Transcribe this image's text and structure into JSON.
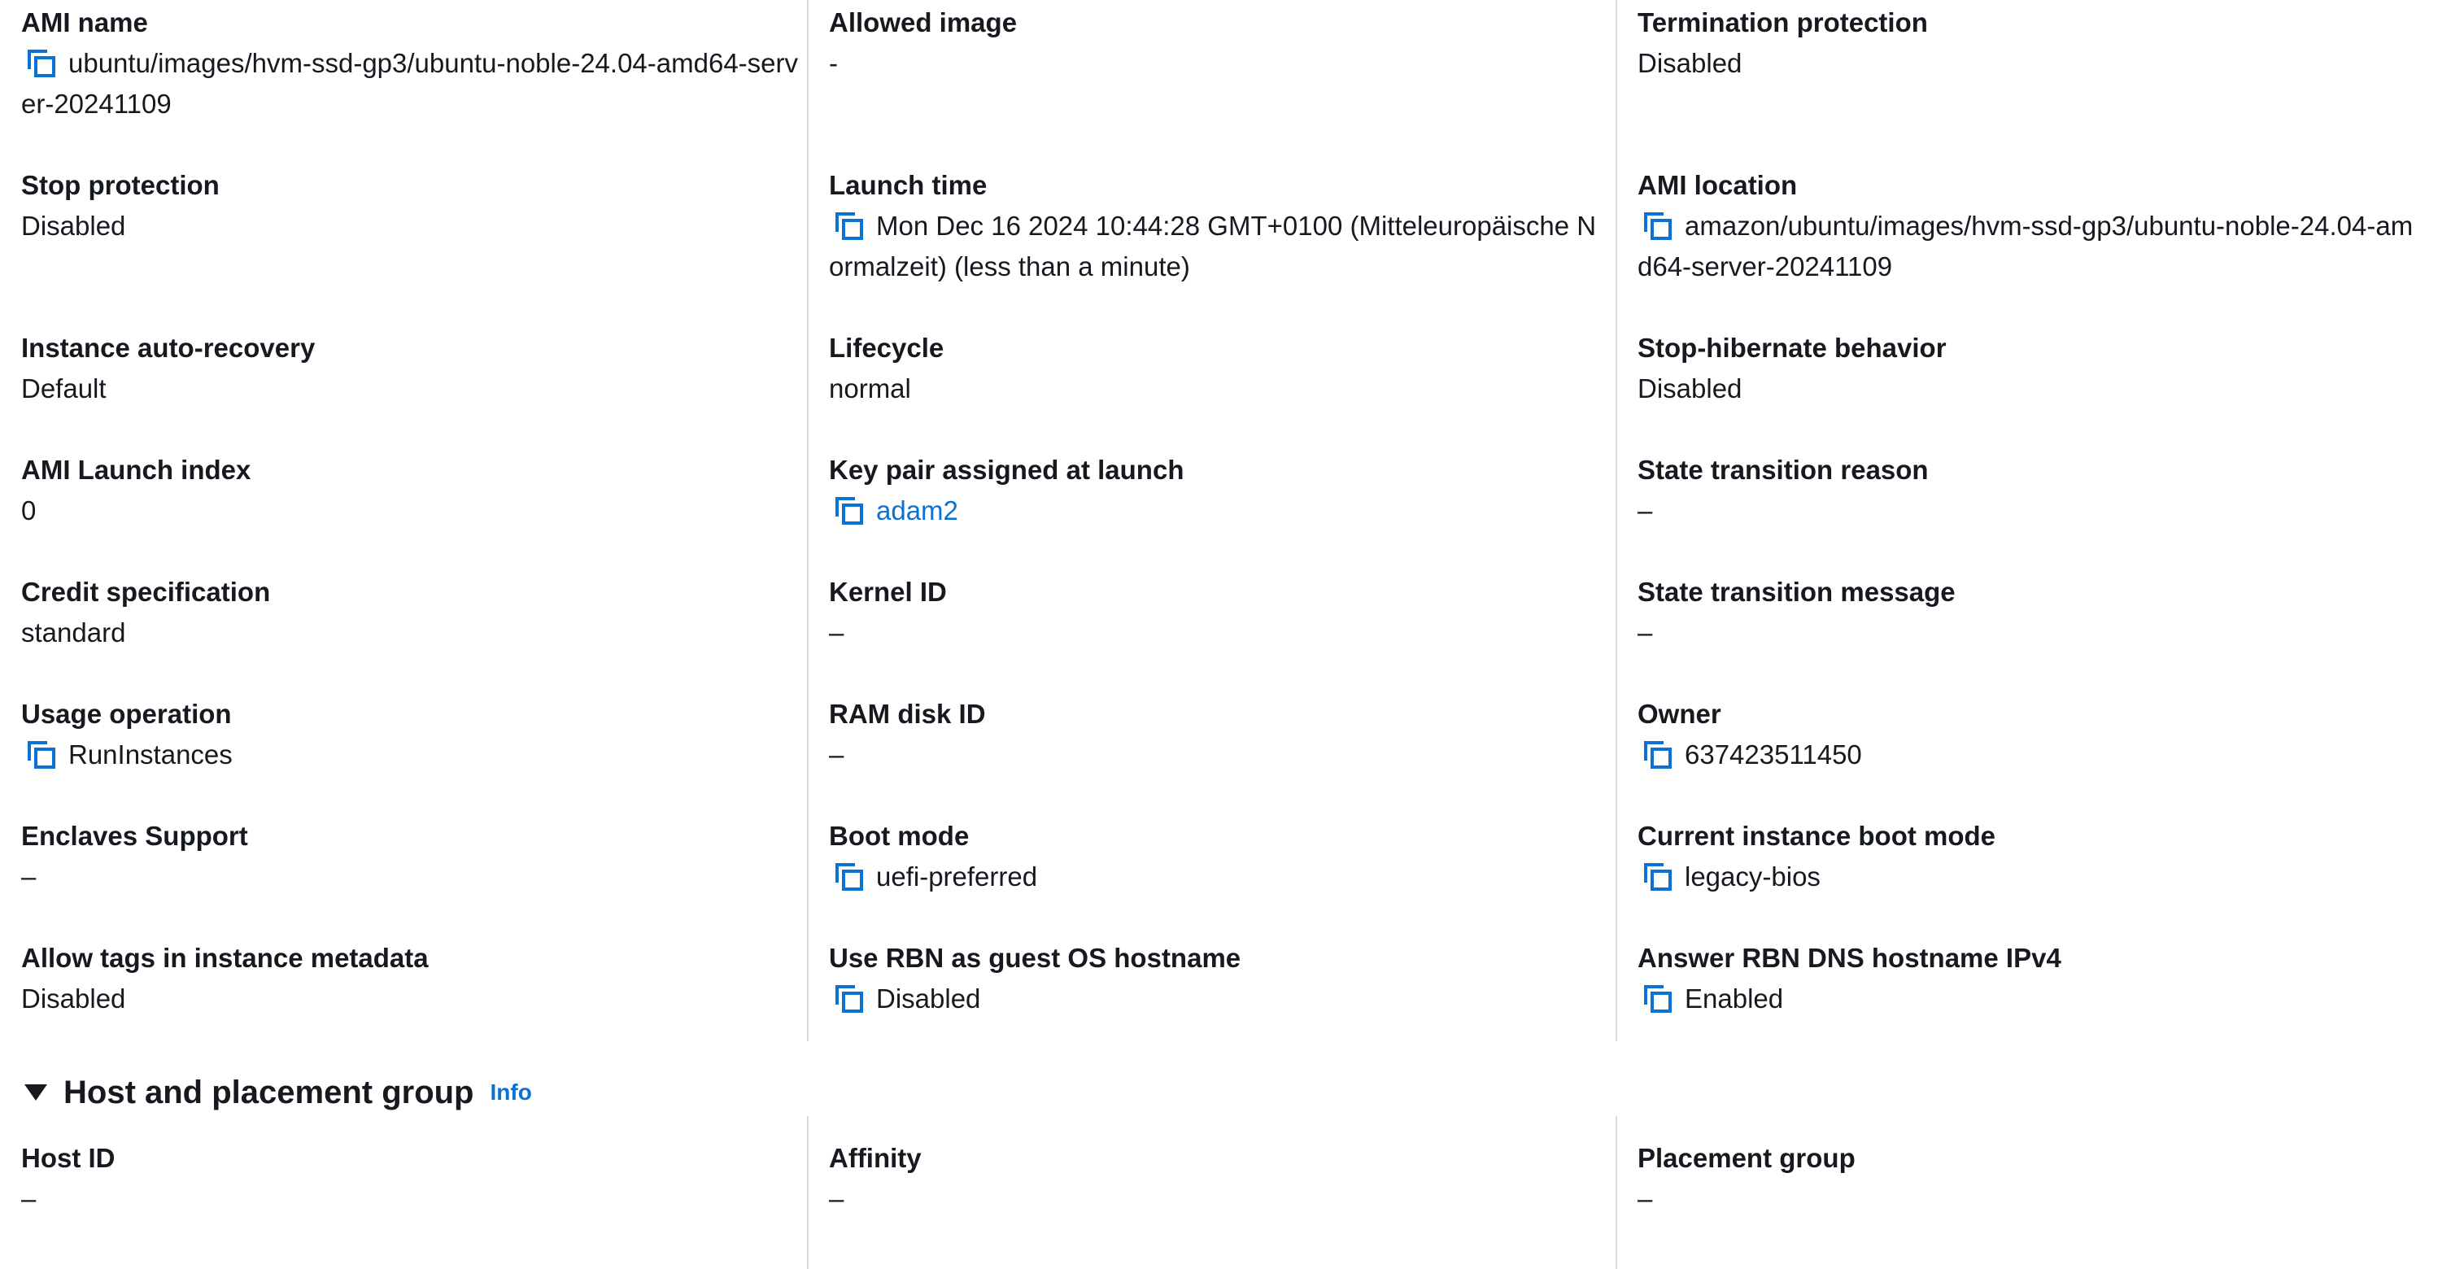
{
  "details": {
    "col0": [
      {
        "label": "AMI name",
        "value": "ubuntu/images/hvm-ssd-gp3/ubuntu-noble-24.04-amd64-server-20241109",
        "copy": true
      },
      {
        "label": "Stop protection",
        "value": "Disabled"
      },
      {
        "label": "Instance auto-recovery",
        "value": "Default"
      },
      {
        "label": "AMI Launch index",
        "value": "0"
      },
      {
        "label": "Credit specification",
        "value": "standard"
      },
      {
        "label": "Usage operation",
        "value": "RunInstances",
        "copy": true
      },
      {
        "label": "Enclaves Support",
        "value": "–"
      },
      {
        "label": "Allow tags in instance metadata",
        "value": "Disabled"
      }
    ],
    "col1": [
      {
        "label": "Allowed image",
        "value": "-"
      },
      {
        "label": "Launch time",
        "value": "Mon Dec 16 2024 10:44:28 GMT+0100 (Mitteleuropäische Normalzeit) (less than a minute)",
        "copy": true
      },
      {
        "label": "Lifecycle",
        "value": "normal"
      },
      {
        "label": "Key pair assigned at launch",
        "value": "adam2",
        "copy": true,
        "link": true
      },
      {
        "label": "Kernel ID",
        "value": "–"
      },
      {
        "label": "RAM disk ID",
        "value": "–"
      },
      {
        "label": "Boot mode",
        "value": "uefi-preferred",
        "copy": true
      },
      {
        "label": "Use RBN as guest OS hostname",
        "value": "Disabled",
        "copy": true
      }
    ],
    "col2": [
      {
        "label": "Termination protection",
        "value": "Disabled"
      },
      {
        "label": "AMI location",
        "value": "amazon/ubuntu/images/hvm-ssd-gp3/ubuntu-noble-24.04-amd64-server-20241109",
        "copy": true
      },
      {
        "label": "Stop-hibernate behavior",
        "value": "Disabled"
      },
      {
        "label": "State transition reason",
        "value": "–"
      },
      {
        "label": "State transition message",
        "value": "–"
      },
      {
        "label": "Owner",
        "value": "637423511450",
        "copy": true
      },
      {
        "label": "Current instance boot mode",
        "value": "legacy-bios",
        "copy": true
      },
      {
        "label": "Answer RBN DNS hostname IPv4",
        "value": "Enabled",
        "copy": true
      }
    ]
  },
  "host_section": {
    "title": "Host and placement group",
    "info": "Info",
    "fields": [
      {
        "label": "Host ID",
        "value": "–"
      },
      {
        "label": "Affinity",
        "value": "–"
      },
      {
        "label": "Placement group",
        "value": "–"
      }
    ]
  },
  "colors": {
    "link": "#0972d3",
    "divider": "#d5dbdb",
    "text": "#16191f"
  }
}
